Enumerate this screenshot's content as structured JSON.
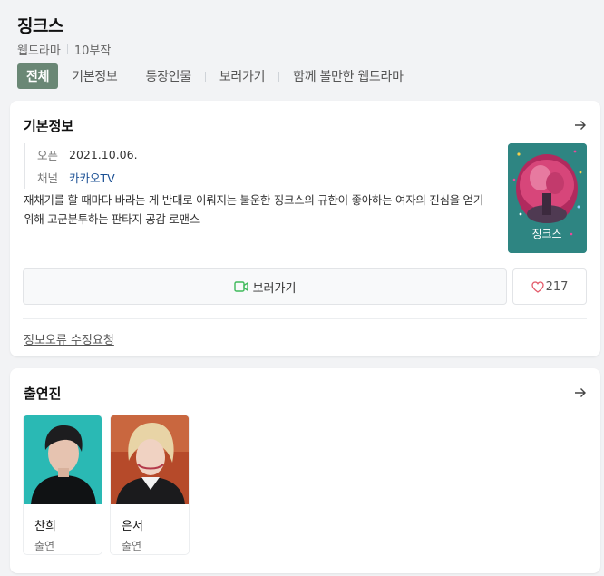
{
  "header": {
    "title": "징크스",
    "genre": "웹드라마",
    "episodes": "10부작"
  },
  "tabs": [
    {
      "label": "전체",
      "active": true
    },
    {
      "label": "기본정보",
      "active": false
    },
    {
      "label": "등장인물",
      "active": false
    },
    {
      "label": "보러가기",
      "active": false
    },
    {
      "label": "함께 볼만한 웹드라마",
      "active": false
    }
  ],
  "basic_info": {
    "title": "기본정보",
    "arrow_icon": "arrow-right-icon",
    "rows": [
      {
        "label": "오픈",
        "value": "2021.10.06."
      },
      {
        "label": "채널",
        "value": "카카오TV"
      }
    ],
    "description": "재채기를 할 때마다 바라는 게 반대로 이뤄지는 불운한 징크스의 규한이 좋아하는 여자의 진심을 얻기 위해 고군분투하는 판타지 공감 로맨스",
    "poster_text": "징크스",
    "watch_label": "보러가기",
    "like_count": "217",
    "report_label": "정보오류 수정요청"
  },
  "cast": {
    "title": "출연진",
    "members": [
      {
        "name": "찬희",
        "role": "출연"
      },
      {
        "name": "은서",
        "role": "출연"
      }
    ]
  },
  "colors": {
    "active_tab": "#6a8775",
    "link": "#1a4f93",
    "play_icon": "#3fba5b",
    "heart_icon": "#e35b6b"
  }
}
